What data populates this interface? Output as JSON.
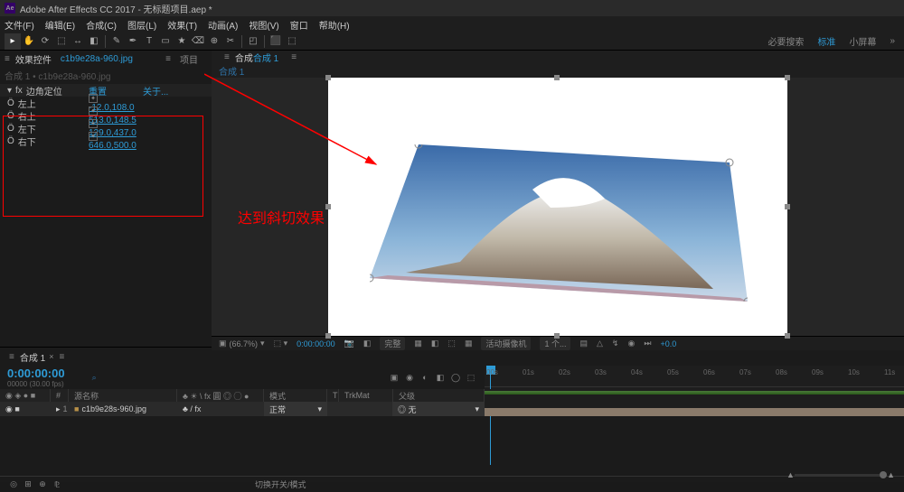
{
  "titlebar": {
    "app": "Adobe After Effects CC 2017 - 无标题项目.aep *",
    "logo": "Ae"
  },
  "menu": [
    "文件(F)",
    "编辑(E)",
    "合成(C)",
    "图层(L)",
    "效果(T)",
    "动画(A)",
    "视图(V)",
    "窗口",
    "帮助(H)"
  ],
  "tools": [
    "▸",
    "✋",
    "⟳",
    "⬚",
    "↔",
    "◧",
    "✎",
    "✒",
    "T",
    "▭",
    "★",
    "⌫",
    "⊕",
    "✂",
    "◰",
    "⬛",
    "⬚"
  ],
  "workspaces": {
    "search": "必要搜索",
    "items": [
      {
        "label": "标准",
        "active": true
      },
      {
        "label": "小屏幕",
        "active": false
      }
    ],
    "arrow": "»"
  },
  "left_panel": {
    "tabs": {
      "menu": "≡",
      "t1": "效果控件",
      "link": "c1b9e28a-960.jpg",
      "t2": "项目"
    },
    "crumb": "合成 1 • c1b9e28a-960.jpg",
    "effect": {
      "name": "边角定位",
      "reset": "重置",
      "about": "关于..."
    },
    "params": [
      {
        "name": "左上",
        "value": "-12.0,108.0",
        "icon": "✦"
      },
      {
        "name": "右上",
        "value": "513.0,148.5",
        "icon": "✦"
      },
      {
        "name": "左下",
        "value": "129.0,437.0",
        "icon": "✦"
      },
      {
        "name": "右下",
        "value": "646.0,500.0",
        "icon": "✦"
      }
    ],
    "stopwatch": "Ö"
  },
  "viewer": {
    "tabs": {
      "menu": "≡",
      "t1": "合成",
      "t2": "合成 1",
      "crumb": "合成 1"
    },
    "annotation": "达到斜切效果",
    "footer": {
      "zoom": "(66.7%)",
      "res": "完整",
      "tc": "0:00:00:00",
      "camera": "活动摄像机",
      "views": "1 个...",
      "adj": "+0.0",
      "icon_cam": "📷",
      "icon_grid": "▦",
      "icon_mask": "◧",
      "icon_tri": "△",
      "icon_arrow": "↯",
      "icon_dot": "◉",
      "icon_fast": "⏭",
      "icon_trans": "▦",
      "icon_layers": "▤"
    }
  },
  "timeline": {
    "tab": "合成 1",
    "close": "×",
    "menu": "≡",
    "time": "0:00:00:00",
    "sub": "00000 (30.00 fps)",
    "search": "⌕",
    "hdr_icons": [
      "▣",
      "◉",
      "◐",
      "◧",
      "◯",
      "⬚"
    ],
    "ticks": [
      "00s",
      "01s",
      "02s",
      "03s",
      "04s",
      "05s",
      "06s",
      "07s",
      "08s",
      "09s",
      "10s",
      "11s"
    ],
    "cols": {
      "bullets": "◉ ◈ ● ■",
      "num": "#",
      "source": "源名称",
      "switches": "♣ ☀ \\ fx 圓 ◎ ◯ ●",
      "mode": "模式",
      "trk_t": "T",
      "trk": "TrkMat",
      "parent": "父级"
    },
    "layer": {
      "bullets": "◉    ■",
      "arrow": "▸",
      "num": "1",
      "color": "■",
      "name": "c1b9e28s-960.jpg",
      "switches": "♣   / fx",
      "mode": "正常",
      "mode_arr": "▾",
      "trk": "",
      "parent": "◎ 无",
      "par_arr": "▾"
    },
    "footer_icons": [
      "◎",
      "⊞",
      "⊕",
      "⅊"
    ],
    "footer_toggle": "切换开关/模式"
  }
}
